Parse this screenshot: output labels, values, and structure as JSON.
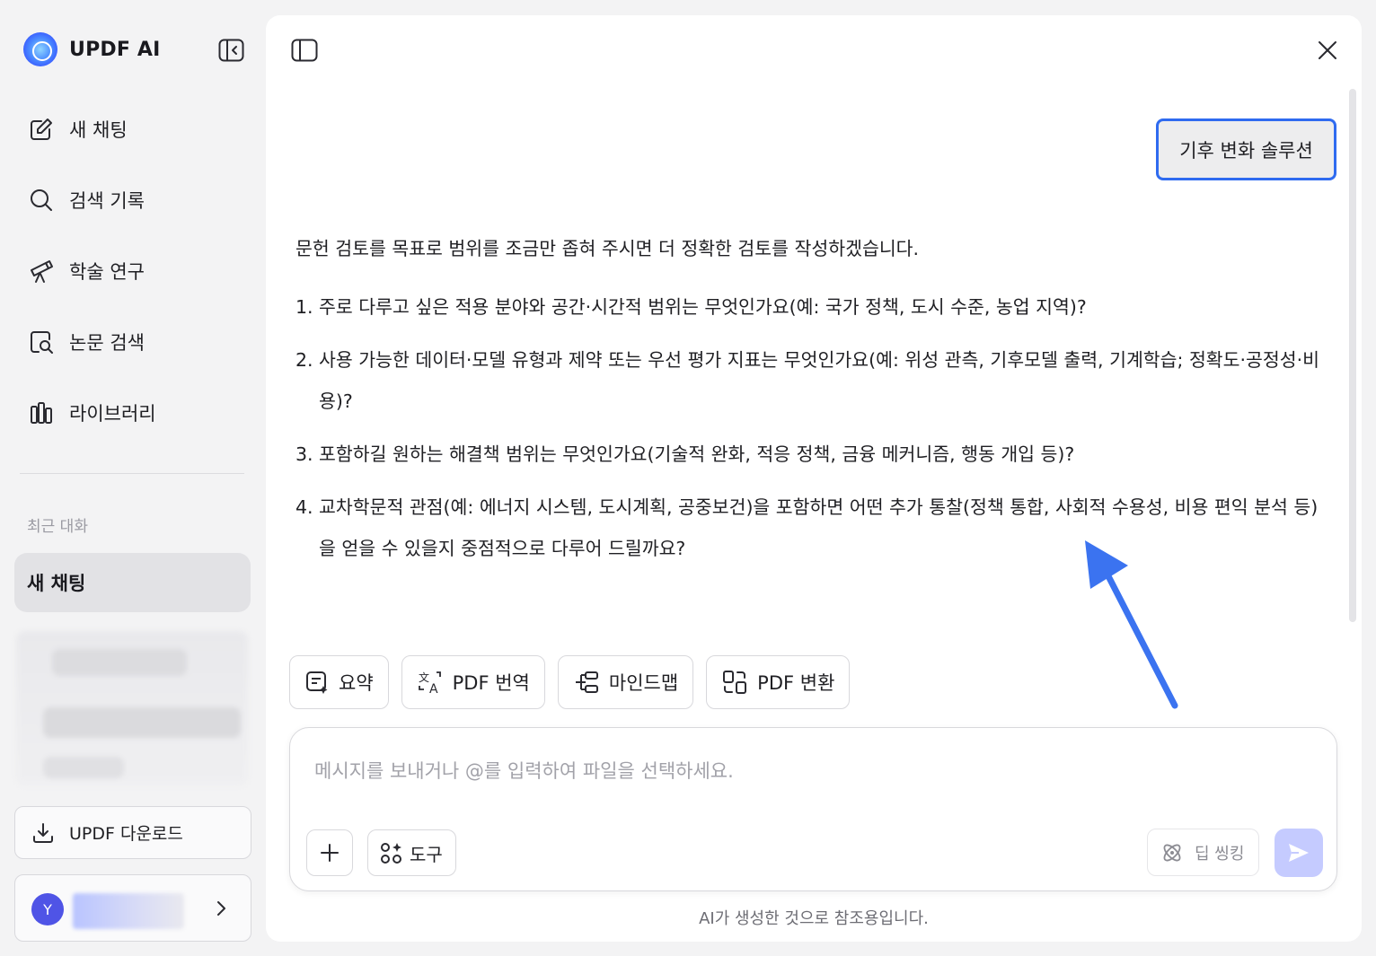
{
  "sidebar": {
    "brand": "UPDF AI",
    "nav": [
      {
        "label": "새 채팅",
        "icon": "edit-icon"
      },
      {
        "label": "검색 기록",
        "icon": "search-icon"
      },
      {
        "label": "학술 연구",
        "icon": "telescope-icon"
      },
      {
        "label": "논문 검색",
        "icon": "paper-search-icon"
      },
      {
        "label": "라이브러리",
        "icon": "library-icon"
      }
    ],
    "recent_label": "최근 대화",
    "recent_active": "새 채팅",
    "download_label": "UPDF 다운로드",
    "user_initial": "Y"
  },
  "chat": {
    "user_message": "기후 변화 솔루션",
    "answer_intro": "문헌 검토를 목표로 범위를 조금만 좁혀 주시면 더 정확한 검토를 작성하겠습니다.",
    "answer_items": [
      {
        "num": "1.",
        "text": "주로 다루고 싶은 적용 분야와 공간·시간적 범위는 무엇인가요(예: 국가 정책, 도시 수준, 농업 지역)?"
      },
      {
        "num": "2.",
        "text": "사용 가능한 데이터·모델 유형과 제약 또는 우선 평가 지표는 무엇인가요(예: 위성 관측, 기후모델 출력, 기계학습; 정확도·공정성·비용)?"
      },
      {
        "num": "3.",
        "text": "포함하길 원하는 해결책 범위는 무엇인가요(기술적 완화, 적응 정책, 금융 메커니즘, 행동 개입 등)?"
      },
      {
        "num": "4.",
        "text": "교차학문적 관점(예: 에너지 시스템, 도시계획, 공중보건)을 포함하면 어떤 추가 통찰(정책 통합, 사회적 수용성, 비용 편익 분석 등)을 얻을 수 있을지 중점적으로 다루어 드릴까요?"
      }
    ]
  },
  "tools": [
    {
      "label": "요약",
      "icon": "summary-icon"
    },
    {
      "label": "PDF 번역",
      "icon": "translate-icon"
    },
    {
      "label": "마인드맵",
      "icon": "mindmap-icon"
    },
    {
      "label": "PDF 변환",
      "icon": "convert-icon"
    }
  ],
  "composer": {
    "placeholder": "메시지를 보내거나 @를 입력하여 파일을 선택하세요.",
    "tools_label": "도구",
    "deep_thinking_label": "딥 씽킹"
  },
  "disclaimer": "AI가 생성한 것으로 참조용입니다.",
  "colors": {
    "accent": "#2f6bf0",
    "send_button": "#c5cbff",
    "annotation_arrow": "#3b73f0"
  }
}
